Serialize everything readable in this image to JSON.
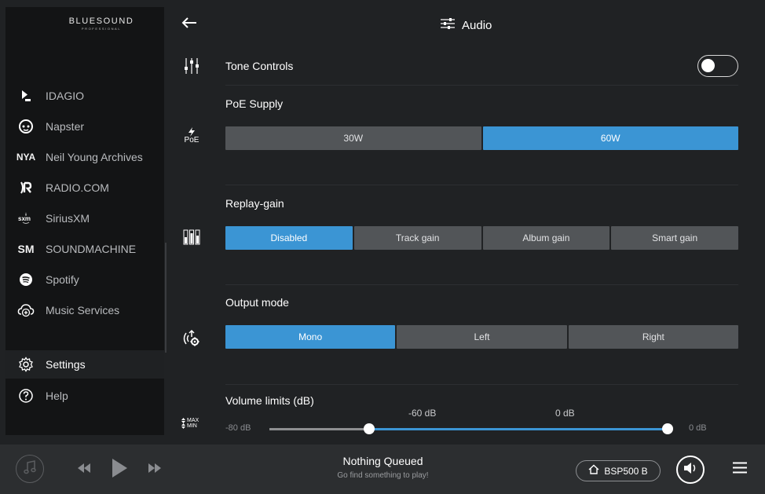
{
  "sidebar": {
    "logo": {
      "main": "BLUESOUND",
      "sub": "PROFESSIONAL"
    },
    "items": [
      {
        "label": "IDAGIO",
        "icon": "idagio-icon",
        "icon_text": ""
      },
      {
        "label": "Napster",
        "icon": "napster-icon",
        "icon_text": ""
      },
      {
        "label": "Neil Young Archives",
        "icon": "nya-icon",
        "icon_text": "NYA"
      },
      {
        "label": "RADIO.COM",
        "icon": "radio-com-icon",
        "icon_text": ""
      },
      {
        "label": "SiriusXM",
        "icon": "siriusxm-icon",
        "icon_text": ""
      },
      {
        "label": "SOUNDMACHINE",
        "icon": "soundmachine-icon",
        "icon_text": "SM"
      },
      {
        "label": "Spotify",
        "icon": "spotify-icon",
        "icon_text": ""
      },
      {
        "label": "Music Services",
        "icon": "cloud-add-icon",
        "icon_text": ""
      },
      {
        "label": "Settings",
        "icon": "gear-icon",
        "icon_text": "",
        "active": true
      },
      {
        "label": "Help",
        "icon": "help-icon",
        "icon_text": ""
      }
    ]
  },
  "header": {
    "title": "Audio",
    "back_icon": "back-arrow-icon",
    "title_icon": "sliders-icon"
  },
  "settings": {
    "tone_controls": {
      "label": "Tone Controls",
      "enabled": false
    },
    "poe_supply": {
      "label": "PoE Supply",
      "icon_text": "PoE",
      "options": [
        "30W",
        "60W"
      ],
      "selected": "60W"
    },
    "replay_gain": {
      "label": "Replay-gain",
      "options": [
        "Disabled",
        "Track gain",
        "Album gain",
        "Smart gain"
      ],
      "selected": "Disabled"
    },
    "output_mode": {
      "label": "Output mode",
      "options": [
        "Mono",
        "Left",
        "Right"
      ],
      "selected": "Mono"
    },
    "volume_limits": {
      "label": "Volume limits (dB)",
      "icon_max": "MAX",
      "icon_min": "MIN",
      "min_label": "-80 dB",
      "max_label": "0 dB",
      "low_value_label": "-60 dB",
      "high_value_label": "0 dB",
      "range_min": -80,
      "range_max": 0,
      "low_value": -60,
      "high_value": 0
    }
  },
  "player": {
    "now_playing_title": "Nothing Queued",
    "now_playing_subtitle": "Go find something to play!",
    "device_name": "BSP500 B"
  },
  "colors": {
    "accent": "#3b95d4",
    "segment_bg": "#525558",
    "sidebar_bg": "#131415",
    "main_bg": "#202224",
    "footer_bg": "#2c2e30"
  }
}
